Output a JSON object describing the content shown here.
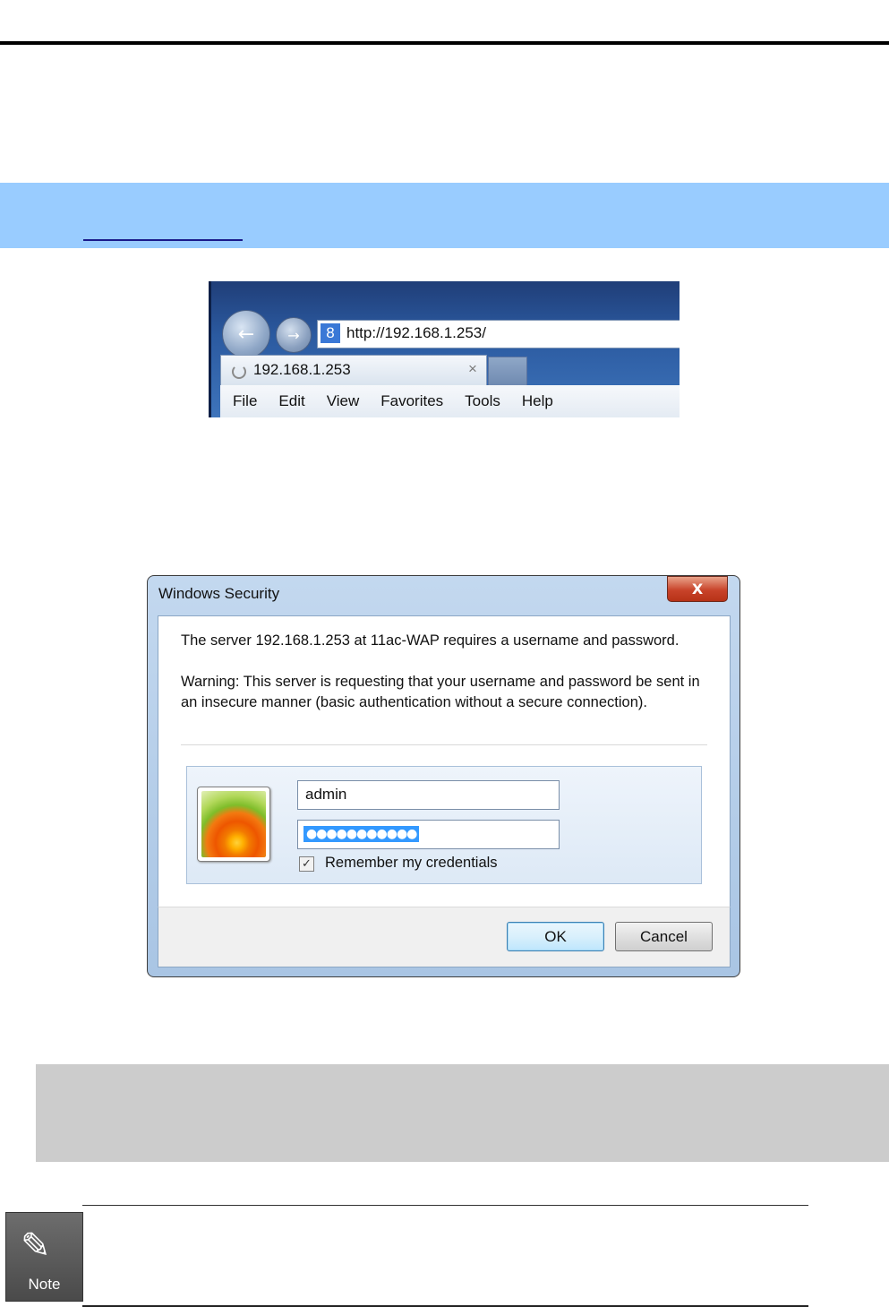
{
  "browser": {
    "address": "http://192.168.1.253/",
    "tab_title": "192.168.1.253",
    "tab_close": "×",
    "back_glyph": "←",
    "forward_glyph": "→",
    "search_glyph": "8",
    "menu": [
      "File",
      "Edit",
      "View",
      "Favorites",
      "Tools",
      "Help"
    ]
  },
  "dialog": {
    "title": "Windows Security",
    "close_glyph": "X",
    "message": "The server 192.168.1.253 at 11ac-WAP requires a username and password.",
    "warning": "Warning: This server is requesting that your username and password be sent in an insecure manner (basic authentication without a secure connection).",
    "username": "admin",
    "password_mask": "●●●●●●●●●●●",
    "remember_checked": "✓",
    "remember_label": "Remember my credentials",
    "ok_label": "OK",
    "cancel_label": "Cancel"
  },
  "note": {
    "label": "Note",
    "glyph": "✎"
  },
  "colors": {
    "blue_band": "#99ccff",
    "gray_band": "#cccccc"
  }
}
